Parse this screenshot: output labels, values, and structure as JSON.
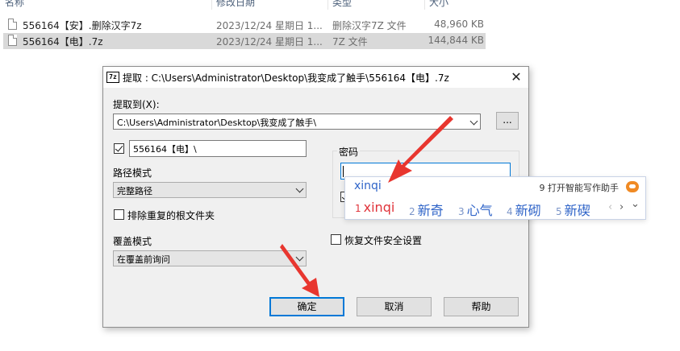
{
  "explorer": {
    "header": {
      "name": "名称",
      "date": "修改日期",
      "type": "类型",
      "size": "大小"
    },
    "files": [
      {
        "name": "556164【安】.删除汉字7z",
        "date": "2023/12/24 星期日 1...",
        "type": "删除汉字7Z 文件",
        "size": "48,960 KB",
        "selected": false
      },
      {
        "name": "556164【电】.7z",
        "date": "2023/12/24 星期日 1...",
        "type": "7Z 文件",
        "size": "144,844 KB",
        "selected": true
      }
    ]
  },
  "dialog": {
    "title": "提取 : C:\\Users\\Administrator\\Desktop\\我变成了触手\\556164【电】.7z",
    "app_icon_text": "7z",
    "close_glyph": "✕",
    "extract_to_label": "提取到(X):",
    "extract_to_value": "C:\\Users\\Administrator\\Desktop\\我变成了触手\\",
    "browse_label": "...",
    "subfolder_checked": true,
    "subfolder_value": "556164【电】\\",
    "path_mode_label": "路径模式",
    "path_mode_value": "完整路径",
    "exclude_dup_label": "排除重复的根文件夹",
    "exclude_dup_checked": false,
    "overwrite_label": "覆盖模式",
    "overwrite_value": "在覆盖前询问",
    "password_label": "密码",
    "password_value": "",
    "restore_security_label": "恢复文件安全设置",
    "restore_security_checked": false,
    "ok_label": "确定",
    "cancel_label": "取消",
    "help_label": "帮助"
  },
  "ime": {
    "composition": "xinqi",
    "hint": "9 打开智能写作助手",
    "candidates": [
      {
        "num": "1",
        "text": "xinqi"
      },
      {
        "num": "2",
        "text": "新奇"
      },
      {
        "num": "3",
        "text": "心气"
      },
      {
        "num": "4",
        "text": "新砌"
      },
      {
        "num": "5",
        "text": "新碶"
      }
    ],
    "prev_glyph": "‹",
    "next_glyph": "›",
    "expand_glyph": "⌄"
  },
  "colors": {
    "accent": "#0078d7",
    "arrow_red": "#e8362f",
    "ime_blue": "#2f64c8",
    "ime_first": "#e0333a",
    "selection_gray": "#d9d9d9"
  }
}
